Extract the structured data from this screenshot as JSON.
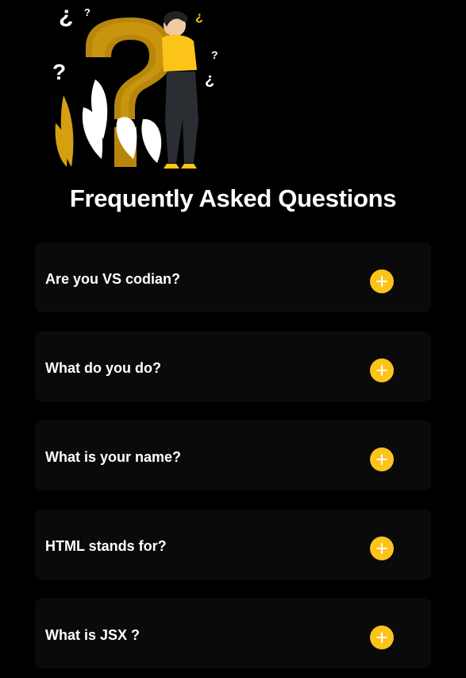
{
  "colors": {
    "background": "#000000",
    "card": "#0a0a0a",
    "accent": "#fcc419",
    "text": "#ffffff"
  },
  "hero": {
    "icon": "question-mark-illustration"
  },
  "page": {
    "title": "Frequently Asked Questions"
  },
  "faq": {
    "items": [
      {
        "question": "Are you VS codian?",
        "icon": "plus-icon"
      },
      {
        "question": "What do you do?",
        "icon": "plus-icon"
      },
      {
        "question": "What is your name?",
        "icon": "plus-icon"
      },
      {
        "question": "HTML stands for?",
        "icon": "plus-icon"
      },
      {
        "question": "What is JSX ?",
        "icon": "plus-icon"
      }
    ]
  }
}
